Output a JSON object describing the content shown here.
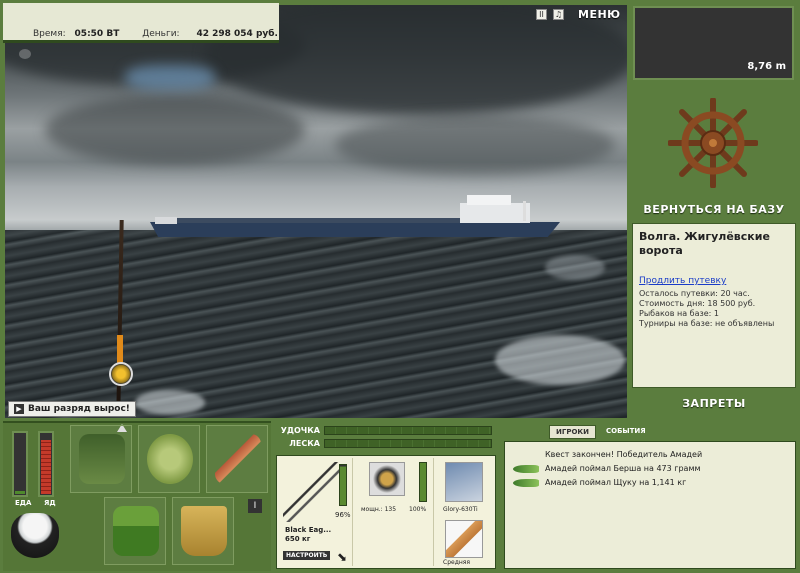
{
  "status": {
    "time_label": "Время:",
    "time_value": "05:50 ВТ",
    "money_label": "Деньги:",
    "money_value": "42 298 054 руб."
  },
  "top_controls": {
    "pause_icon": "pause-icon",
    "sound_icon": "sound-icon",
    "menu_label": "МЕНЮ"
  },
  "scene": {
    "rank_message": "Ваш разряд вырос!"
  },
  "depth": {
    "value": "8,76 m"
  },
  "base": {
    "return_label": "ВЕРНУТЬСЯ НА БАЗУ",
    "location_name": "Волга. Жигулёвские ворота",
    "extend_link": "Продлить путевку",
    "lines": [
      "Осталось путевки: 20 час.",
      "Стоимость дня: 18 500 руб.",
      "Рыбаков на базе: 1",
      "Турниры на базе: не объявлены"
    ],
    "forbidden_label": "ЗАПРЕТЫ"
  },
  "meters": {
    "food_label": "ЕДА",
    "poison_label": "ЯД",
    "food_level": 0.05,
    "poison_level": 0.9
  },
  "inventory": {
    "scroll_label": "I"
  },
  "tackle": {
    "rod_label": "УДОЧКА",
    "line_label": "ЛЕСКА",
    "rod_condition": "96%",
    "rod_name": "Black Eag...",
    "rod_weight": "650 кг",
    "adjust_label": "НАСТРОИТЬ",
    "reel_power": "мощн.: 135",
    "reel_condition": "100%",
    "line_name": "Glory-630Ti",
    "bait_name": "Средняя"
  },
  "events": {
    "tab_players": "ИГРОКИ",
    "tab_events": "СОБЫТИЯ",
    "items": [
      "Квест закончен! Победитель Амадей",
      "Амадей поймал Берша на 473 грамм",
      "Амадей поймал Щуку на 1,141 кг"
    ]
  }
}
